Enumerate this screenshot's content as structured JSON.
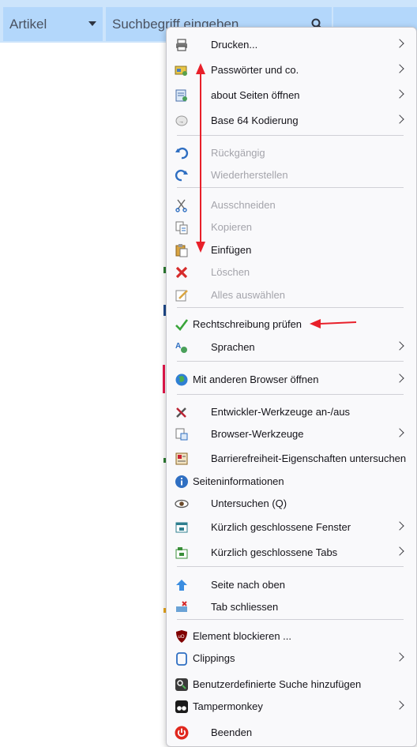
{
  "search_bar": {
    "category": "Artikel",
    "placeholder": "Suchbegriff eingeben"
  },
  "menu": {
    "drucken": "Drucken...",
    "passwoerter": "Passwörter und co.",
    "about": "about Seiten öffnen",
    "base64": "Base 64 Kodierung",
    "rueckgaengig": "Rückgängig",
    "wiederherstellen": "Wiederherstellen",
    "ausschneiden": "Ausschneiden",
    "kopieren": "Kopieren",
    "einfuegen": "Einfügen",
    "loeschen": "Löschen",
    "alles_auswaehlen": "Alles auswählen",
    "rechtschreibung": "Rechtschreibung prüfen",
    "sprachen": "Sprachen",
    "anderer_browser": "Mit anderen Browser öffnen",
    "entwickler": "Entwickler-Werkzeuge an-/aus",
    "browser_werkzeuge": "Browser-Werkzeuge",
    "barrierefreiheit": "Barrierefreiheit-Eigenschaften untersuchen",
    "seiteninfo": "Seiteninformationen",
    "untersuchen": "Untersuchen (Q)",
    "geschl_fenster": "Kürzlich geschlossene Fenster",
    "geschl_tabs": "Kürzlich geschlossene Tabs",
    "seite_oben": "Seite nach oben",
    "tab_schliessen": "Tab schliessen",
    "element_blockieren": "Element blockieren ...",
    "clippings": "Clippings",
    "suche_hinzufuegen": "Benutzerdefinierte Suche hinzufügen",
    "tampermonkey": "Tampermonkey",
    "beenden": "Beenden"
  },
  "colors": {
    "annotation_arrow": "#e8202a",
    "topbar": "#cce4fb",
    "field": "#b3d7fb"
  }
}
